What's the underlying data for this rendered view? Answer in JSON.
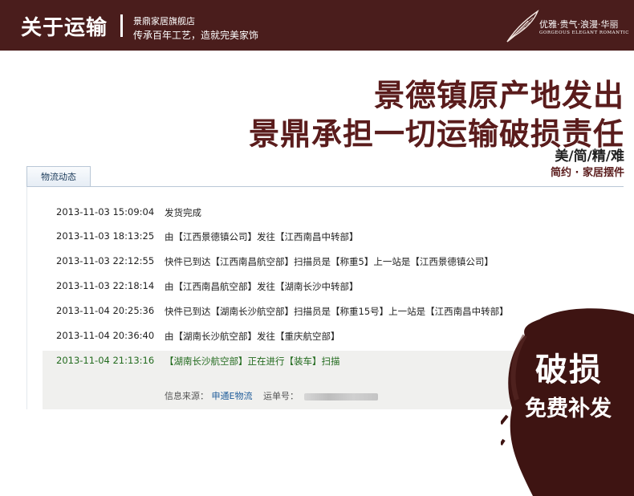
{
  "banner": {
    "title": "关于运输",
    "shop_name": "景鼎家居旗舰店",
    "motto": "传承百年工艺，造就完美家饰",
    "slogan": "优雅·贵气·浪漫·华丽",
    "slogan_en": "GORGEOUS ELEGANT ROMANTIC",
    "bg_color": "#4a1d1c"
  },
  "headline": {
    "line1": "景德镇原产地发出",
    "line2": "景鼎承担一切运输破损责任",
    "tag1": "美/简/精/难",
    "tag2": "简约 · 家居摆件",
    "color": "#5a1c1c"
  },
  "tracking": {
    "tab_label": "物流动态",
    "entries": [
      {
        "time": "2013-11-03 15:09:04",
        "desc": "发货完成"
      },
      {
        "time": "2013-11-03 18:13:25",
        "desc": "由【江西景德镇公司】发往【江西南昌中转部】"
      },
      {
        "time": "2013-11-03 22:12:55",
        "desc": "快件已到达【江西南昌航空部】扫描员是【称重5】上一站是【江西景德镇公司】"
      },
      {
        "time": "2013-11-03 22:18:14",
        "desc": "由【江西南昌航空部】发往【湖南长沙中转部】"
      },
      {
        "time": "2013-11-04 20:25:36",
        "desc": "快件已到达【湖南长沙航空部】扫描员是【称重15号】上一站是【江西南昌中转部】"
      },
      {
        "time": "2013-11-04 20:36:40",
        "desc": "由【湖南长沙航空部】发往【重庆航空部】"
      },
      {
        "time": "2013-11-04 21:13:16",
        "desc": "【湖南长沙航空部】正在进行【装车】扫描"
      }
    ],
    "info_label": "信息来源：",
    "info_source": "申通E物流",
    "waybill_label": "运单号：",
    "latest_color": "#236b1f"
  },
  "stamp": {
    "line1": "破损",
    "line2": "免费补发",
    "color": "#3e1412"
  }
}
